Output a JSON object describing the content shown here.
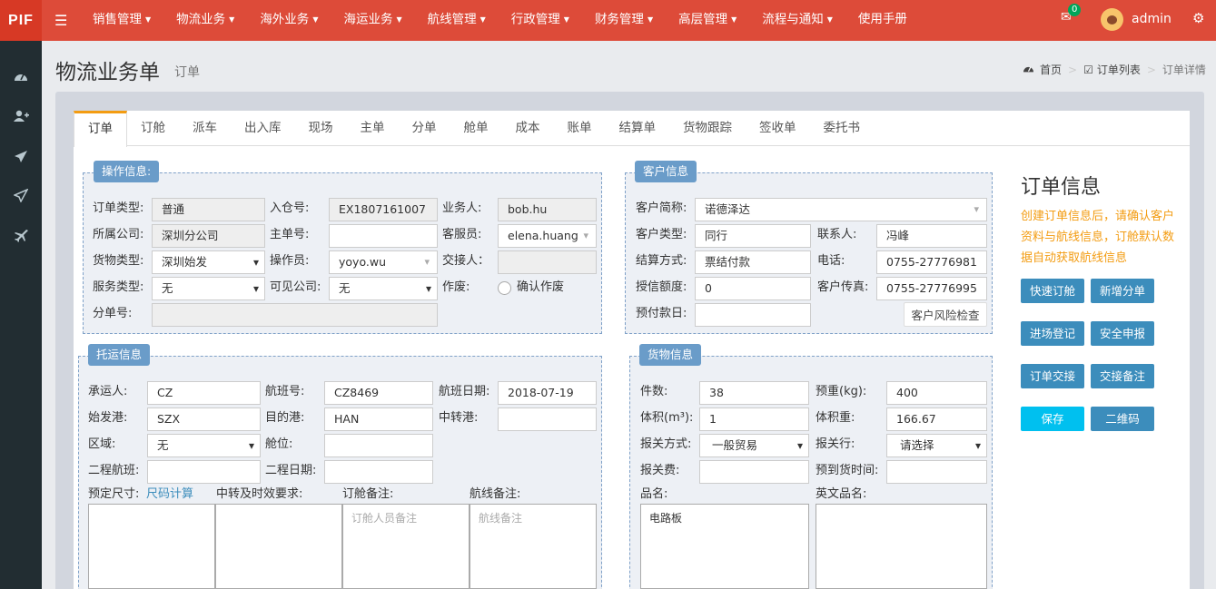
{
  "topbar": {
    "logo": "PIF",
    "menu": [
      "销售管理",
      "物流业务",
      "海外业务",
      "海运业务",
      "航线管理",
      "行政管理",
      "财务管理",
      "高层管理",
      "流程与通知",
      "使用手册"
    ],
    "mail_badge": "0",
    "username": "admin",
    "colors": {
      "bar": "#dd4b39",
      "sidebar": "#222d32",
      "accent": "#3c8dbc"
    }
  },
  "sidebar": {
    "icons": [
      "dashboard-icon",
      "add-user-icon",
      "send-icon",
      "send-outline-icon",
      "plane-icon"
    ]
  },
  "page": {
    "title": "物流业务单",
    "subtitle": "订单",
    "breadcrumb": {
      "home": "首页",
      "list": "订单列表",
      "current": "订单详情"
    }
  },
  "tabs": [
    "订单",
    "订舱",
    "派车",
    "出入库",
    "现场",
    "主单",
    "分单",
    "舱单",
    "成本",
    "账单",
    "结算单",
    "货物跟踪",
    "签收单",
    "委托书"
  ],
  "operation": {
    "legend": "操作信息:",
    "order_type_label": "订单类型:",
    "order_type": "普通",
    "warehouse_no_label": "入仓号:",
    "warehouse_no": "EX1807161007",
    "salesman_label": "业务人:",
    "salesman": "bob.hu",
    "company_label": "所属公司:",
    "company": "深圳分公司",
    "master_no_label": "主单号:",
    "master_no": "",
    "cs_label": "客服员:",
    "cs": "elena.huang",
    "cargo_type_label": "货物类型:",
    "cargo_type": "深圳始发",
    "operator_label": "操作员:",
    "operator": "yoyo.wu",
    "handover_label": "交接人：",
    "handover": "",
    "service_type_label": "服务类型:",
    "service_type": "无",
    "visible_company_label": "可见公司:",
    "visible_company": "无",
    "void_label": "作废:",
    "void_option": "确认作废",
    "sub_no_label": "分单号:",
    "sub_no": ""
  },
  "customer": {
    "legend": "客户信息",
    "short_name_label": "客户简称:",
    "short_name": "诺德泽达",
    "type_label": "客户类型:",
    "type": "同行",
    "contact_label": "联系人:",
    "contact": "冯峰",
    "settle_label": "结算方式:",
    "settle": "票结付款",
    "phone_label": "电话:",
    "phone": "0755-27776981",
    "credit_label": "授信额度:",
    "credit": "0",
    "fax_label": "客户传真:",
    "fax": "0755-27776995",
    "prepay_label": "预付款日:",
    "prepay": "",
    "risk_button": "客户风险检查"
  },
  "shipping": {
    "legend": "托运信息",
    "carrier_label": "承运人:",
    "carrier": "CZ",
    "flight_label": "航班号:",
    "flight": "CZ8469",
    "flight_date_label": "航班日期:",
    "flight_date": "2018-07-19",
    "origin_label": "始发港:",
    "origin": "SZX",
    "dest_label": "目的港:",
    "dest": "HAN",
    "transit_label": "中转港:",
    "transit": "",
    "region_label": "区域:",
    "region": "无",
    "cabin_label": "舱位:",
    "cabin": "",
    "second_flight_label": "二程航班:",
    "second_flight": "",
    "second_date_label": "二程日期:",
    "second_date": "",
    "size_label": "预定尺寸:",
    "size_link": "尺码计算",
    "transit_req_label": "中转及时效要求:",
    "booking_note_label": "订舱备注:",
    "booking_note_placeholder": "订舱人员备注",
    "route_note_label": "航线备注:",
    "route_note_placeholder": "航线备注"
  },
  "cargo": {
    "legend": "货物信息",
    "pieces_label": "件数:",
    "pieces": "38",
    "weight_label": "预重(kg):",
    "weight": "400",
    "volume_label": "体积(m³):",
    "volume": "1",
    "vol_weight_label": "体积重:",
    "vol_weight": "166.67",
    "customs_mode_label": "报关方式:",
    "customs_mode": "一般贸易",
    "broker_label": "报关行:",
    "broker": "请选择",
    "customs_fee_label": "报关费:",
    "customs_fee": "",
    "arrival_label": "预到货时间:",
    "arrival": "",
    "name_label": "品名:",
    "name": "电路板",
    "en_name_label": "英文品名:",
    "en_name": ""
  },
  "side_info": {
    "title": "订单信息",
    "desc": "创建订单信息后，请确认客户资料与航线信息，订舱默认数据自动获取航线信息",
    "buttons": [
      "快速订舱",
      "新增分单",
      "进场登记",
      "安全申报",
      "订单交接",
      "交接备注",
      "保存",
      "二维码"
    ]
  }
}
